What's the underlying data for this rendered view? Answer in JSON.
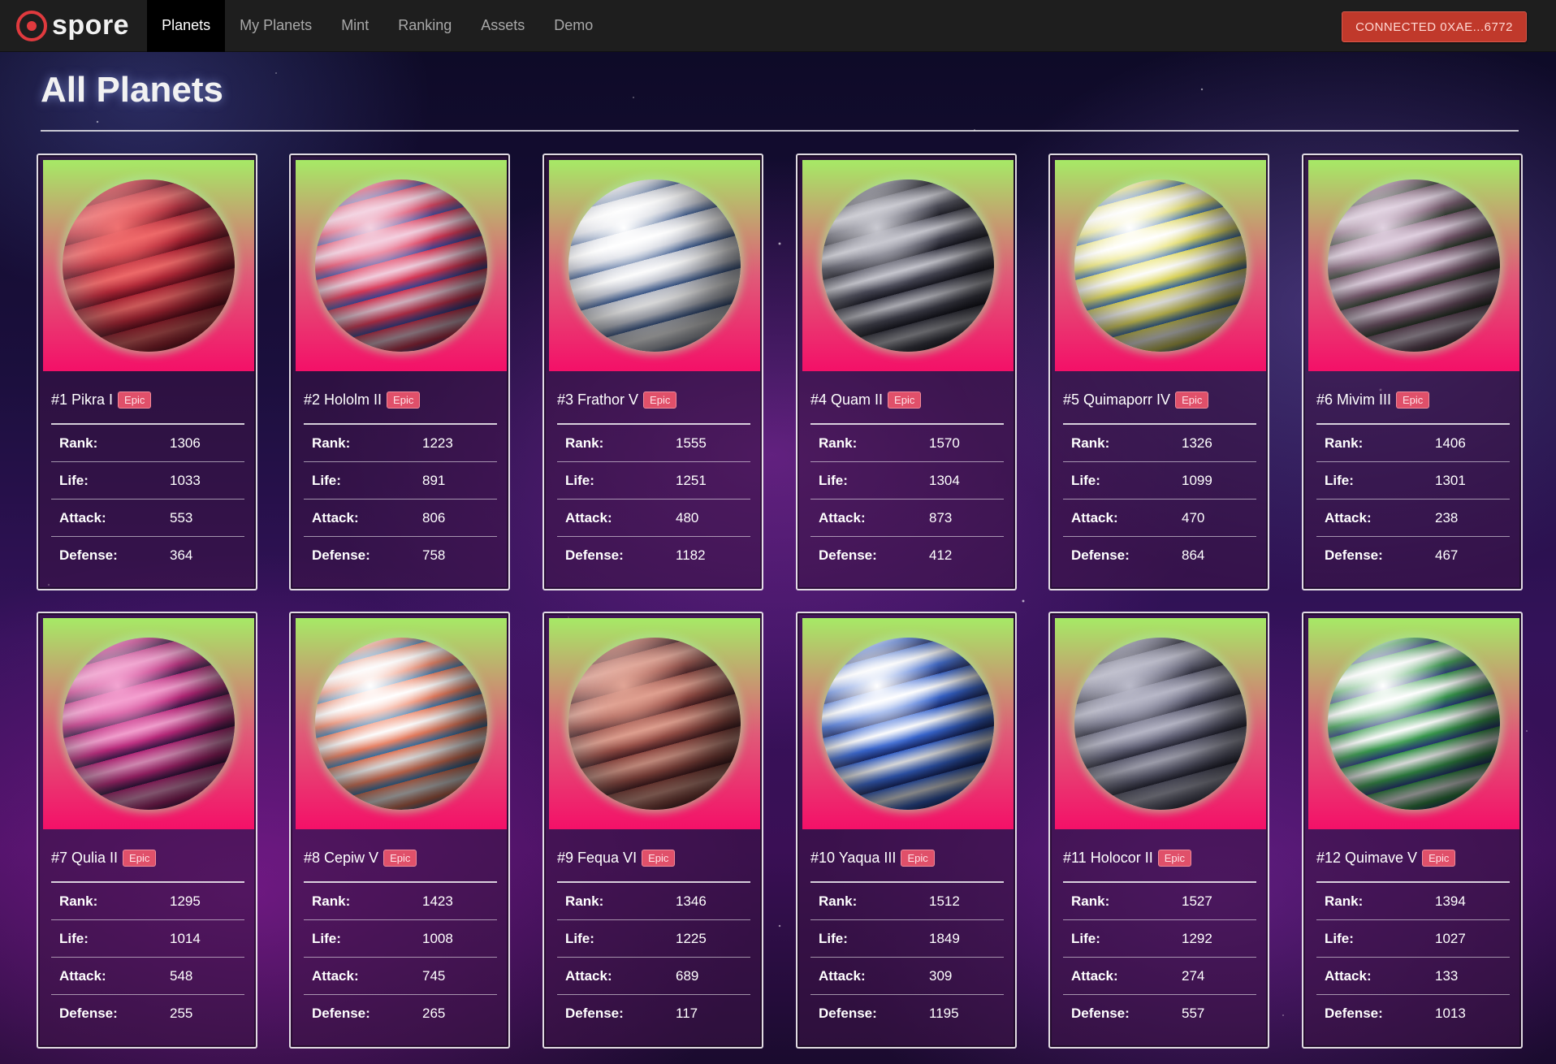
{
  "brand": {
    "name": "spore"
  },
  "nav": {
    "items": [
      "Planets",
      "My Planets",
      "Mint",
      "Ranking",
      "Assets",
      "Demo"
    ],
    "active": "Planets",
    "connect_label": "CONNECTED 0XAE...6772"
  },
  "page": {
    "title": "All Planets"
  },
  "stat_labels": {
    "rank": "Rank:",
    "life": "Life:",
    "attack": "Attack:",
    "defense": "Defense:"
  },
  "planets": [
    {
      "title": "#1 Pikra I",
      "badge": "Epic",
      "rank": "1306",
      "life": "1033",
      "attack": "553",
      "defense": "364",
      "colors": [
        "#f06a6a",
        "#b82a3a",
        "#6a1020"
      ]
    },
    {
      "title": "#2 Hololm II",
      "badge": "Epic",
      "rank": "1223",
      "life": "891",
      "attack": "806",
      "defense": "758",
      "colors": [
        "#f4d0e0",
        "#e23a5a",
        "#3a4aa0"
      ]
    },
    {
      "title": "#3 Frathor V",
      "badge": "Epic",
      "rank": "1555",
      "life": "1251",
      "attack": "480",
      "defense": "1182",
      "colors": [
        "#ffffff",
        "#c8ccd8",
        "#3a5a90"
      ]
    },
    {
      "title": "#4 Quam II",
      "badge": "Epic",
      "rank": "1570",
      "life": "1304",
      "attack": "873",
      "defense": "412",
      "colors": [
        "#c8c8d0",
        "#4a4a58",
        "#1a1a24"
      ]
    },
    {
      "title": "#5 Quimaporr IV",
      "badge": "Epic",
      "rank": "1326",
      "life": "1099",
      "attack": "470",
      "defense": "864",
      "colors": [
        "#ffffff",
        "#e8e060",
        "#3a70b0"
      ]
    },
    {
      "title": "#6 Mivim III",
      "badge": "Epic",
      "rank": "1406",
      "life": "1301",
      "attack": "238",
      "defense": "467",
      "colors": [
        "#e0d0e0",
        "#7a5a70",
        "#2a3a2a"
      ]
    },
    {
      "title": "#7 Qulia II",
      "badge": "Epic",
      "rank": "1295",
      "life": "1014",
      "attack": "548",
      "defense": "255",
      "colors": [
        "#f4a0d0",
        "#c02a80",
        "#3a1a4a"
      ]
    },
    {
      "title": "#8 Cepiw V",
      "badge": "Epic",
      "rank": "1423",
      "life": "1008",
      "attack": "745",
      "defense": "265",
      "colors": [
        "#ffffff",
        "#f08060",
        "#3a7ab0"
      ]
    },
    {
      "title": "#9 Fequa VI",
      "badge": "Epic",
      "rank": "1346",
      "life": "1225",
      "attack": "689",
      "defense": "117",
      "colors": [
        "#e0a090",
        "#9a5048",
        "#4a2024"
      ]
    },
    {
      "title": "#10 Yaqua III",
      "badge": "Epic",
      "rank": "1512",
      "life": "1849",
      "attack": "309",
      "defense": "1195",
      "colors": [
        "#ffffff",
        "#3a6ad8",
        "#1a2a6a"
      ]
    },
    {
      "title": "#11 Holocor II",
      "badge": "Epic",
      "rank": "1527",
      "life": "1292",
      "attack": "274",
      "defense": "557",
      "colors": [
        "#b8b8c8",
        "#6a6a80",
        "#2a2a3a"
      ]
    },
    {
      "title": "#12 Quimave V",
      "badge": "Epic",
      "rank": "1394",
      "life": "1027",
      "attack": "133",
      "defense": "1013",
      "colors": [
        "#ffffff",
        "#3aa050",
        "#2a3a80"
      ]
    }
  ]
}
